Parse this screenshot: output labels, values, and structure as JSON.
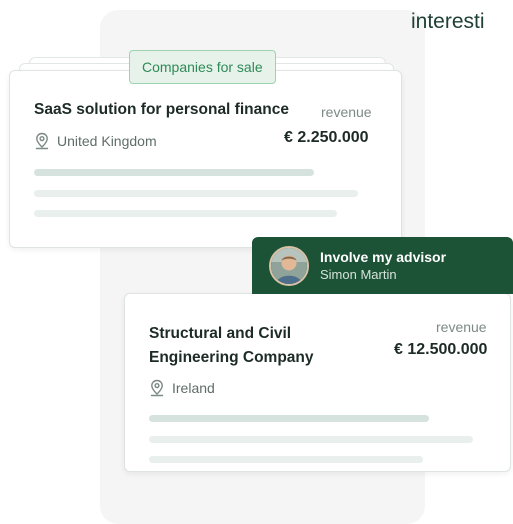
{
  "corner_text": "interesti",
  "sale_tag": "Companies for sale",
  "listing1": {
    "title": "SaaS solution for personal finance",
    "revenue_label": "revenue",
    "revenue_value": "€ 2.250.000",
    "location": "United Kingdom",
    "location_icon": "map-pin-icon"
  },
  "advisor": {
    "title": "Involve my advisor",
    "name": "Simon Martin"
  },
  "listing2": {
    "title_line1": "Structural and Civil",
    "title_line2": "Engineering Company",
    "revenue_label": "revenue",
    "revenue_value": "€ 12.500.000",
    "location": "Ireland",
    "location_icon": "map-pin-icon"
  },
  "colors": {
    "brand_green": "#1c5235",
    "tag_green": "#2f8a58",
    "tag_bg": "#e6f2ea",
    "placeholder_bar": "#d6e2de"
  }
}
